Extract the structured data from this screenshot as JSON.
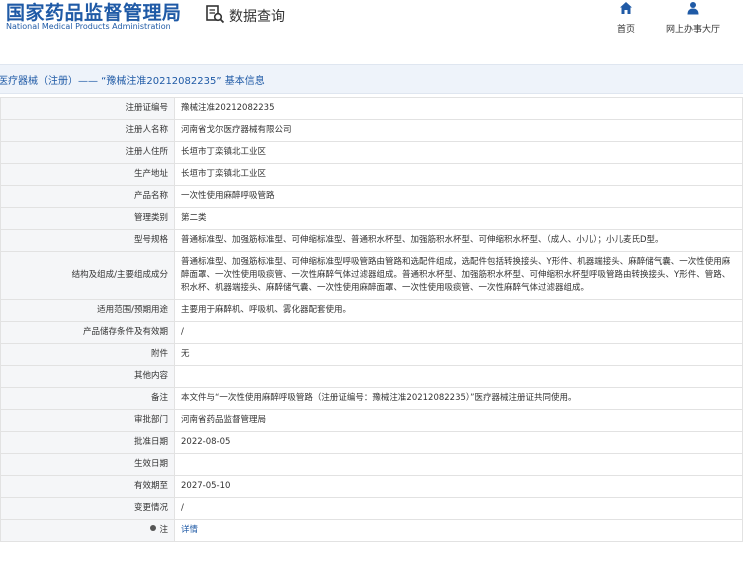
{
  "header": {
    "logo_cn": "国家药品监督管理局",
    "logo_en": "National Medical Products Administration",
    "query_label": "数据查询",
    "nav": [
      {
        "label": "首页",
        "icon": "home-icon"
      },
      {
        "label": "网上办事大厅",
        "icon": "user-icon"
      }
    ]
  },
  "breadcrumb": "医疗器械（注册）—— “豫械注准20212082235” 基本信息",
  "rows": [
    {
      "label": "注册证编号",
      "value": "豫械注准20212082235"
    },
    {
      "label": "注册人名称",
      "value": "河南省戈尔医疗器械有限公司"
    },
    {
      "label": "注册人住所",
      "value": "长垣市丁栾镇北工业区"
    },
    {
      "label": "生产地址",
      "value": "长垣市丁栾镇北工业区"
    },
    {
      "label": "产品名称",
      "value": "一次性使用麻醉呼吸管路"
    },
    {
      "label": "管理类别",
      "value": "第二类"
    },
    {
      "label": "型号规格",
      "value": "普通标准型、加强筋标准型、可伸缩标准型、普通积水杯型、加强筋积水杯型、可伸缩积水杯型、（成人、小儿）；小儿麦氏D型。"
    },
    {
      "label": "结构及组成/主要组成成分",
      "value": "普通标准型、加强筋标准型、可伸缩标准型呼吸管路由管路和选配件组成，选配件包括转换接头、Y形件、机器端接头、麻醉储气囊、一次性使用麻醉面罩、一次性使用吸痰管、一次性麻醉气体过滤器组成。普通积水杯型、加强筋积水杯型、可伸缩积水杯型呼吸管路由转换接头、Y形件、管路、积水杯、机器端接头、麻醉储气囊、一次性使用麻醉面罩、一次性使用吸痰管、一次性麻醉气体过滤器组成。"
    },
    {
      "label": "适用范围/预期用途",
      "value": "主要用于麻醉机、呼吸机、雾化器配套使用。"
    },
    {
      "label": "产品储存条件及有效期",
      "value": "/"
    },
    {
      "label": "附件",
      "value": "无"
    },
    {
      "label": "其他内容",
      "value": ""
    },
    {
      "label": "备注",
      "value": "本文件与“一次性使用麻醉呼吸管路（注册证编号：豫械注准20212082235）”医疗器械注册证共同使用。"
    },
    {
      "label": "审批部门",
      "value": "河南省药品监督管理局"
    },
    {
      "label": "批准日期",
      "value": "2022-08-05"
    },
    {
      "label": "生效日期",
      "value": ""
    },
    {
      "label": "有效期至",
      "value": "2027-05-10"
    },
    {
      "label": "变更情况",
      "value": "/"
    },
    {
      "label": "注",
      "value": "详情"
    }
  ],
  "colors": {
    "brand": "#1f5aa6",
    "label_bg": "#f5f6f8",
    "crumb_bg": "#eef3fa"
  }
}
